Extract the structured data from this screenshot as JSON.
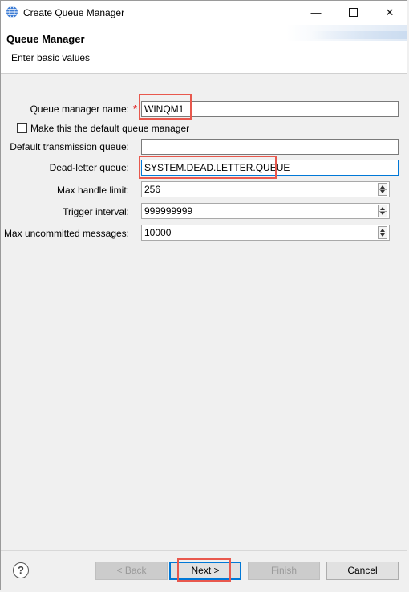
{
  "window": {
    "title": "Create Queue Manager"
  },
  "header": {
    "title": "Queue Manager",
    "subtitle": "Enter basic values"
  },
  "form": {
    "qm_name_label": "Queue manager name:",
    "qm_name_required_mark": "*",
    "qm_name_value": "WINQM1",
    "default_qm_label": "Make this the default queue manager",
    "default_qm_checked": false,
    "transmission_label": "Default transmission queue:",
    "transmission_value": "",
    "deadletter_label": "Dead-letter queue:",
    "deadletter_value": "SYSTEM.DEAD.LETTER.QUEUE",
    "max_handle_label": "Max handle limit:",
    "max_handle_value": "256",
    "trigger_label": "Trigger interval:",
    "trigger_value": "999999999",
    "max_uncommitted_label": "Max uncommitted messages:",
    "max_uncommitted_value": "10000"
  },
  "buttons": {
    "help_icon": "?",
    "back": "< Back",
    "next": "Next >",
    "finish": "Finish",
    "cancel": "Cancel"
  },
  "icons": {
    "app": "globe-icon",
    "minimize": "minimize-icon",
    "maximize": "maximize-icon",
    "close": "close-icon"
  },
  "colors": {
    "highlight": "#e8584d",
    "focus": "#0078d7",
    "required": "#e03a3a"
  }
}
